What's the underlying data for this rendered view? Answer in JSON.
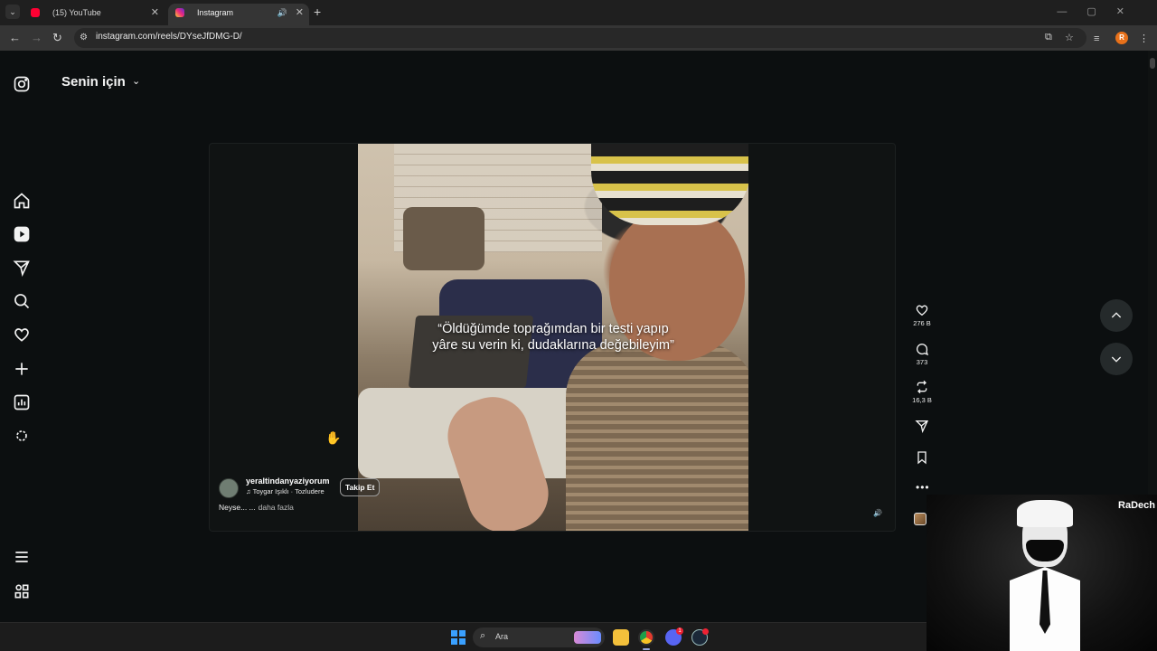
{
  "browser": {
    "tabs": [
      {
        "title": "(15) YouTube",
        "favicon": "youtube-icon"
      },
      {
        "title": "Instagram",
        "favicon": "instagram-icon",
        "active": true,
        "audio": true
      }
    ],
    "url": "instagram.com/reels/DYseJfDMG-D/",
    "profile_initial": "R"
  },
  "instagram": {
    "feed_title": "Senin için",
    "sidebar_icons": [
      "instagram-logo-icon",
      "home-icon",
      "reels-icon",
      "messages-icon",
      "search-icon",
      "notifications-heart-icon",
      "create-plus-icon",
      "dashboard-icon",
      "meta-ai-icon",
      "menu-icon",
      "also-from-meta-icon"
    ],
    "reel": {
      "caption_line1": "“Öldüğümde toprağımdan bir testi yapıp",
      "caption_line2": "yâre su verin ki, dudaklarına değebileyim”",
      "username": "yeraltindanyaziyorum",
      "audio": "Toygar Işıklı · Tozludere",
      "follow_label": "Takip Et",
      "description": "Neyse... ...",
      "more_label": "daha fazla"
    },
    "actions": {
      "likes": "276 B",
      "comments": "373",
      "reposts": "16,3 B"
    }
  },
  "overlay": {
    "name": "RaDech"
  },
  "taskbar": {
    "search_placeholder": "Ara",
    "discord_badge": "1"
  },
  "colors": {
    "accent_profile": "#e8711a",
    "background": "#0c0f10"
  }
}
